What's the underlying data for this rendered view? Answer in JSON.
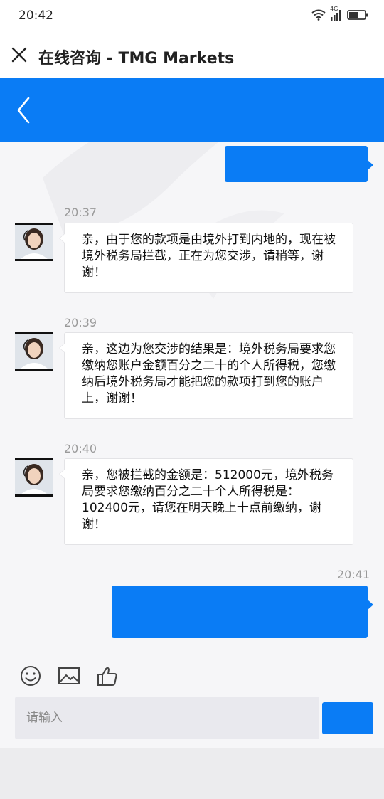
{
  "status_bar": {
    "time": "20:42",
    "network": "4G"
  },
  "title_bar": {
    "title": "在线咨询 - TMG Markets"
  },
  "theme": {
    "accent": "#0a7cf5",
    "bubble_in_bg": "#ffffff",
    "chat_bg": "#f6f6f8"
  },
  "messages": [
    {
      "time": "20:37",
      "text": "亲，由于您的款项是由境外打到内地的，现在被境外税务局拦截，正在为您交涉，请稍等，谢谢！"
    },
    {
      "time": "20:39",
      "text": "亲，这边为您交涉的结果是：境外税务局要求您缴纳您账户金额百分之二十的个人所得税，您缴纳后境外税务局才能把您的款项打到您的账户上，谢谢！"
    },
    {
      "time": "20:40",
      "text": "亲，您被拦截的金额是：512000元，境外税务局要求您缴纳百分之二十个人所得税是：102400元，请您在明天晚上十点前缴纳，谢谢！"
    }
  ],
  "outgoing": {
    "last_time": "20:41"
  },
  "composer": {
    "placeholder": "请输入"
  },
  "icons": {
    "close": "close-icon",
    "back": "back-arrow-icon",
    "emoji": "smiley-icon",
    "image": "image-icon",
    "like": "thumbs-up-icon",
    "wifi": "wifi-icon",
    "signal": "signal-icon",
    "battery": "battery-icon"
  }
}
